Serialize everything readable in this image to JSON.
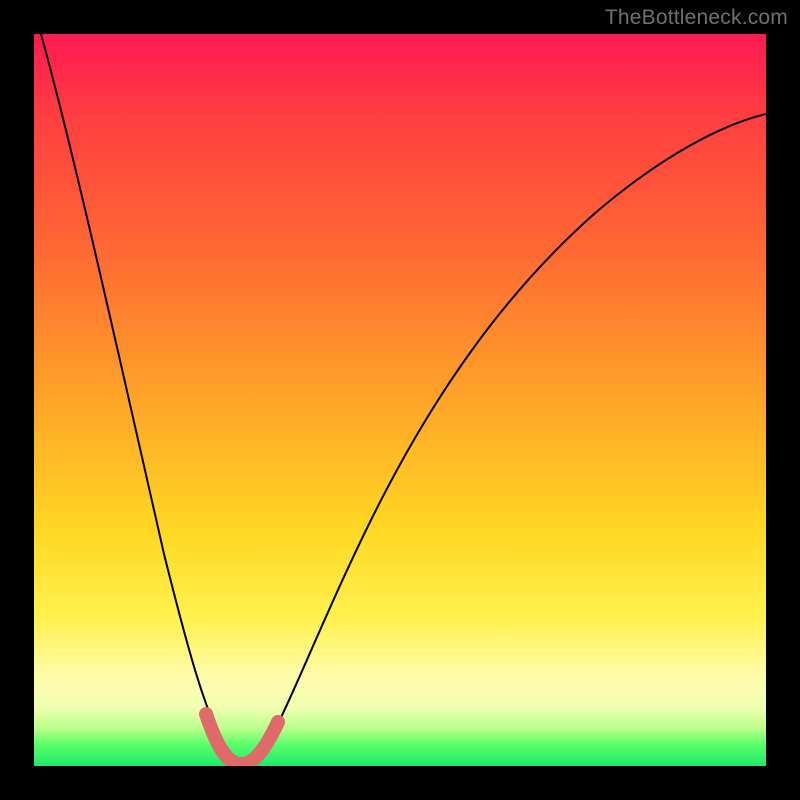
{
  "watermark": "TheBottleneck.com",
  "chart_data": {
    "type": "line",
    "title": "",
    "xlabel": "",
    "ylabel": "",
    "xlim": [
      0,
      100
    ],
    "ylim": [
      0,
      100
    ],
    "series": [
      {
        "name": "bottleneck-curve",
        "x": [
          1,
          3,
          5,
          8,
          11,
          14,
          17,
          20,
          23,
          25,
          27,
          29,
          31,
          33,
          36,
          40,
          45,
          50,
          55,
          60,
          65,
          70,
          75,
          80,
          85,
          90,
          95,
          100
        ],
        "y": [
          100,
          88,
          76,
          60,
          46,
          34,
          24,
          14,
          6,
          2,
          0,
          0,
          2,
          6,
          14,
          26,
          38,
          48,
          56,
          63,
          69,
          74,
          78,
          81,
          84,
          86,
          88,
          89
        ]
      },
      {
        "name": "optimal-zone-highlight",
        "x": [
          23,
          24,
          25,
          26,
          27,
          28,
          29,
          30,
          31,
          32,
          33
        ],
        "y": [
          6,
          3,
          1.5,
          0.8,
          0.5,
          0.5,
          0.8,
          1.5,
          3,
          5,
          7
        ]
      }
    ],
    "gradient_stops": [
      {
        "pos": 0,
        "color": "#ff1a52"
      },
      {
        "pos": 12,
        "color": "#ff4040"
      },
      {
        "pos": 30,
        "color": "#ff6a33"
      },
      {
        "pos": 50,
        "color": "#ffa528"
      },
      {
        "pos": 68,
        "color": "#ffd824"
      },
      {
        "pos": 80,
        "color": "#fff250"
      },
      {
        "pos": 88,
        "color": "#fffcae"
      },
      {
        "pos": 92,
        "color": "#f2ffb0"
      },
      {
        "pos": 95,
        "color": "#b6ff8a"
      },
      {
        "pos": 97,
        "color": "#5dff6a"
      },
      {
        "pos": 100,
        "color": "#1de86e"
      }
    ]
  }
}
